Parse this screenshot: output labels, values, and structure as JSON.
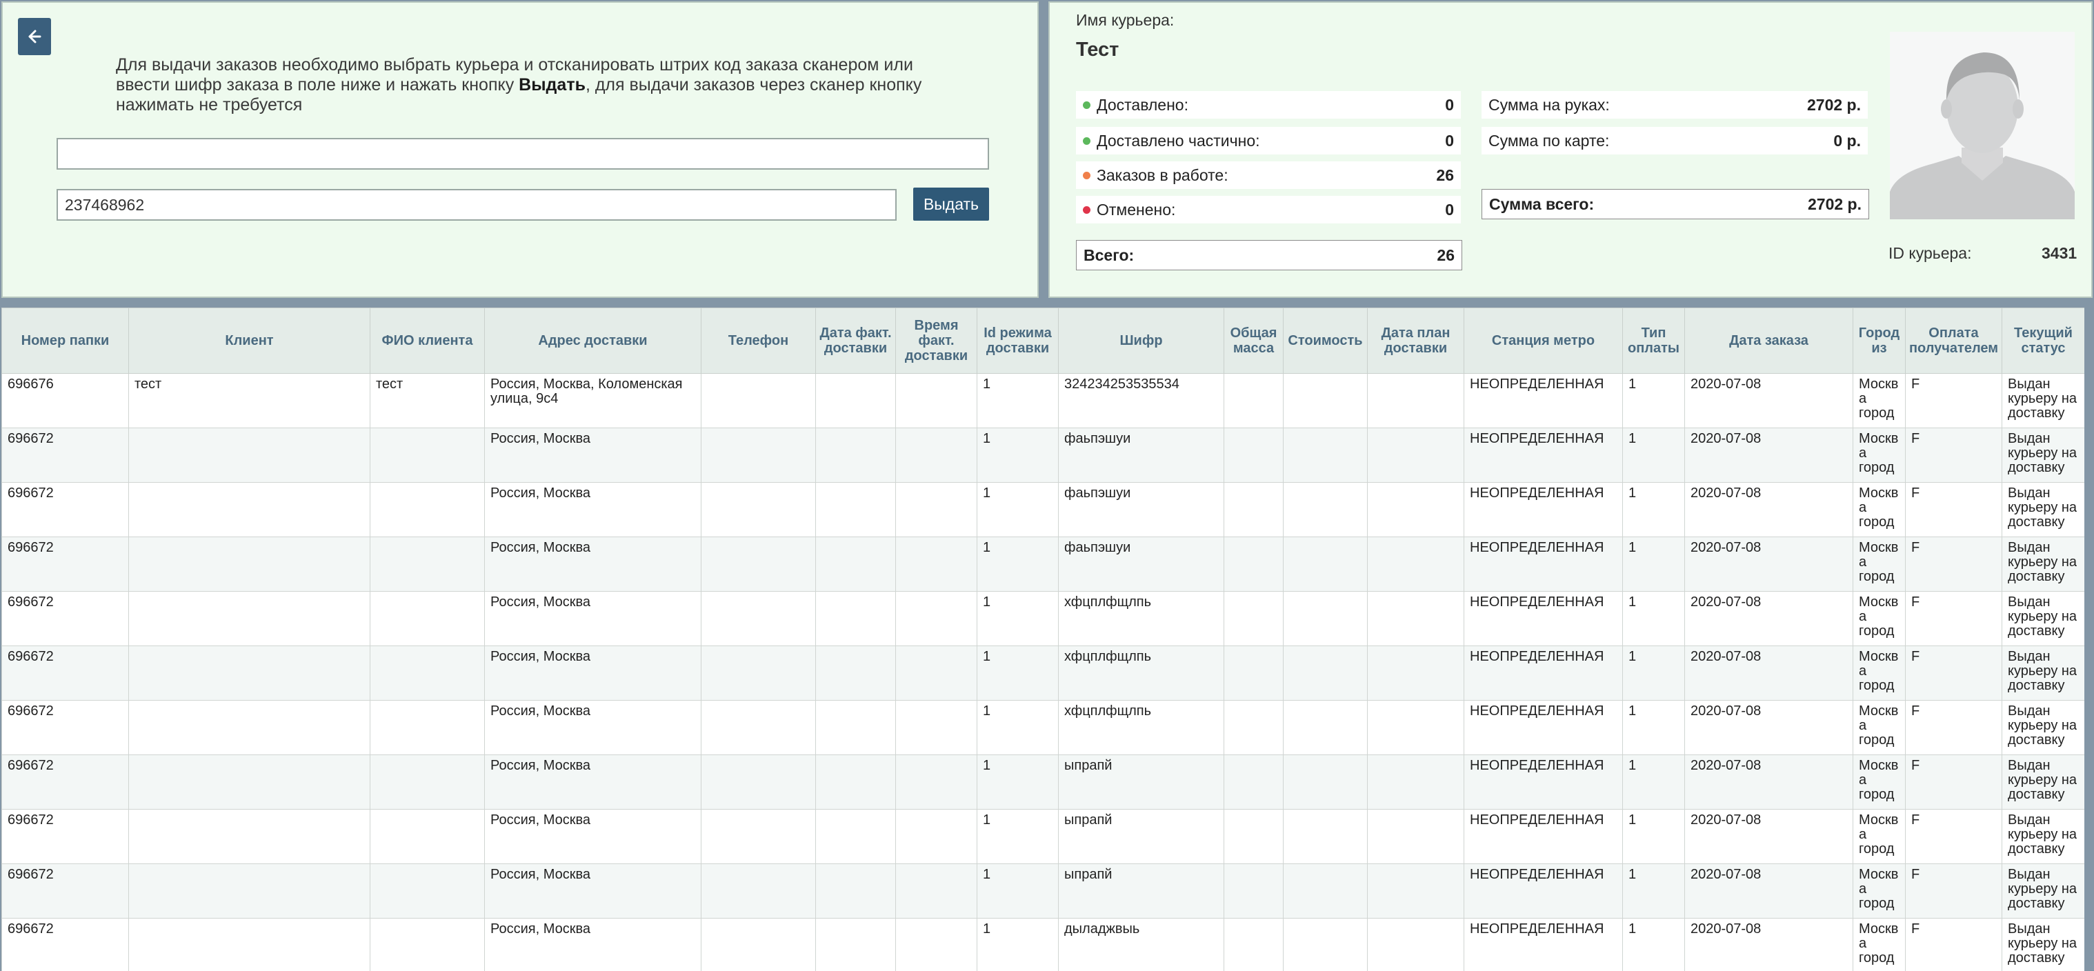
{
  "left": {
    "back_icon": "arrow-left-icon",
    "instruction_part1": "Для выдачи заказов необходимо выбрать курьера и отсканировать штрих код заказа сканером или ввести шифр заказа в поле ниже и нажать кнопку ",
    "instruction_bold": "Выдать",
    "instruction_part2": ", для выдачи заказов через сканер кнопку нажимать не требуется",
    "courier_input_value": "",
    "shifr_input_value": "237468962",
    "issue_button": "Выдать"
  },
  "courier": {
    "name_label": "Имя курьера:",
    "name": "Тест",
    "stats": [
      {
        "label": "Доставлено:",
        "value": "0",
        "color": "#5cb85c"
      },
      {
        "label": "Доставлено частично:",
        "value": "0",
        "color": "#5cb85c"
      },
      {
        "label": "Заказов в работе:",
        "value": "26",
        "color": "#f0804a"
      },
      {
        "label": "Отменено:",
        "value": "0",
        "color": "#e0344a"
      }
    ],
    "total_label": "Всего:",
    "total_value": "26",
    "sum_hands_label": "Сумма на руках:",
    "sum_hands_value": "2702 р.",
    "sum_card_label": "Сумма по карте:",
    "sum_card_value": "0 р.",
    "sum_total_label": "Сумма всего:",
    "sum_total_value": "2702 р.",
    "id_label": "ID курьера:",
    "id_value": "3431",
    "avatar_icon": "person-avatar-icon"
  },
  "table": {
    "headers": [
      "Номер папки",
      "Клиент",
      "ФИО клиента",
      "Адрес доставки",
      "Телефон",
      "Дата факт. доставки",
      "Время факт. доставки",
      "Id режима доставки",
      "Шифр",
      "Общая масса",
      "Стоимость",
      "Дата план доставки",
      "Станция метро",
      "Тип оплаты",
      "Дата заказа",
      "Город из",
      "Оплата получателем",
      "Текущий статус"
    ],
    "rows": [
      [
        "696676",
        "тест",
        "тест",
        "Россия, Москва, Коломенская улица, 9с4",
        "",
        "",
        "",
        "1",
        "324234253535534",
        "",
        "",
        "",
        "НЕОПРЕДЕЛЕННАЯ",
        "1",
        "2020-07-08",
        "Москва город",
        "F",
        "Выдан курьеру на доставку"
      ],
      [
        "696672",
        "",
        "",
        "Россия, Москва",
        "",
        "",
        "",
        "1",
        "фаьпэшуи",
        "",
        "",
        "",
        "НЕОПРЕДЕЛЕННАЯ",
        "1",
        "2020-07-08",
        "Москва город",
        "F",
        "Выдан курьеру на доставку"
      ],
      [
        "696672",
        "",
        "",
        "Россия, Москва",
        "",
        "",
        "",
        "1",
        "фаьпэшуи",
        "",
        "",
        "",
        "НЕОПРЕДЕЛЕННАЯ",
        "1",
        "2020-07-08",
        "Москва город",
        "F",
        "Выдан курьеру на доставку"
      ],
      [
        "696672",
        "",
        "",
        "Россия, Москва",
        "",
        "",
        "",
        "1",
        "фаьпэшуи",
        "",
        "",
        "",
        "НЕОПРЕДЕЛЕННАЯ",
        "1",
        "2020-07-08",
        "Москва город",
        "F",
        "Выдан курьеру на доставку"
      ],
      [
        "696672",
        "",
        "",
        "Россия, Москва",
        "",
        "",
        "",
        "1",
        "хфцплфщлпь",
        "",
        "",
        "",
        "НЕОПРЕДЕЛЕННАЯ",
        "1",
        "2020-07-08",
        "Москва город",
        "F",
        "Выдан курьеру на доставку"
      ],
      [
        "696672",
        "",
        "",
        "Россия, Москва",
        "",
        "",
        "",
        "1",
        "хфцплфщлпь",
        "",
        "",
        "",
        "НЕОПРЕДЕЛЕННАЯ",
        "1",
        "2020-07-08",
        "Москва город",
        "F",
        "Выдан курьеру на доставку"
      ],
      [
        "696672",
        "",
        "",
        "Россия, Москва",
        "",
        "",
        "",
        "1",
        "хфцплфщлпь",
        "",
        "",
        "",
        "НЕОПРЕДЕЛЕННАЯ",
        "1",
        "2020-07-08",
        "Москва город",
        "F",
        "Выдан курьеру на доставку"
      ],
      [
        "696672",
        "",
        "",
        "Россия, Москва",
        "",
        "",
        "",
        "1",
        "ыпрапй",
        "",
        "",
        "",
        "НЕОПРЕДЕЛЕННАЯ",
        "1",
        "2020-07-08",
        "Москва город",
        "F",
        "Выдан курьеру на доставку"
      ],
      [
        "696672",
        "",
        "",
        "Россия, Москва",
        "",
        "",
        "",
        "1",
        "ыпрапй",
        "",
        "",
        "",
        "НЕОПРЕДЕЛЕННАЯ",
        "1",
        "2020-07-08",
        "Москва город",
        "F",
        "Выдан курьеру на доставку"
      ],
      [
        "696672",
        "",
        "",
        "Россия, Москва",
        "",
        "",
        "",
        "1",
        "ыпрапй",
        "",
        "",
        "",
        "НЕОПРЕДЕЛЕННАЯ",
        "1",
        "2020-07-08",
        "Москва город",
        "F",
        "Выдан курьеру на доставку"
      ],
      [
        "696672",
        "",
        "",
        "Россия, Москва",
        "",
        "",
        "",
        "1",
        "дыладжвыь",
        "",
        "",
        "",
        "НЕОПРЕДЕЛЕННАЯ",
        "1",
        "2020-07-08",
        "Москва город",
        "F",
        "Выдан курьеру на доставку"
      ]
    ]
  }
}
